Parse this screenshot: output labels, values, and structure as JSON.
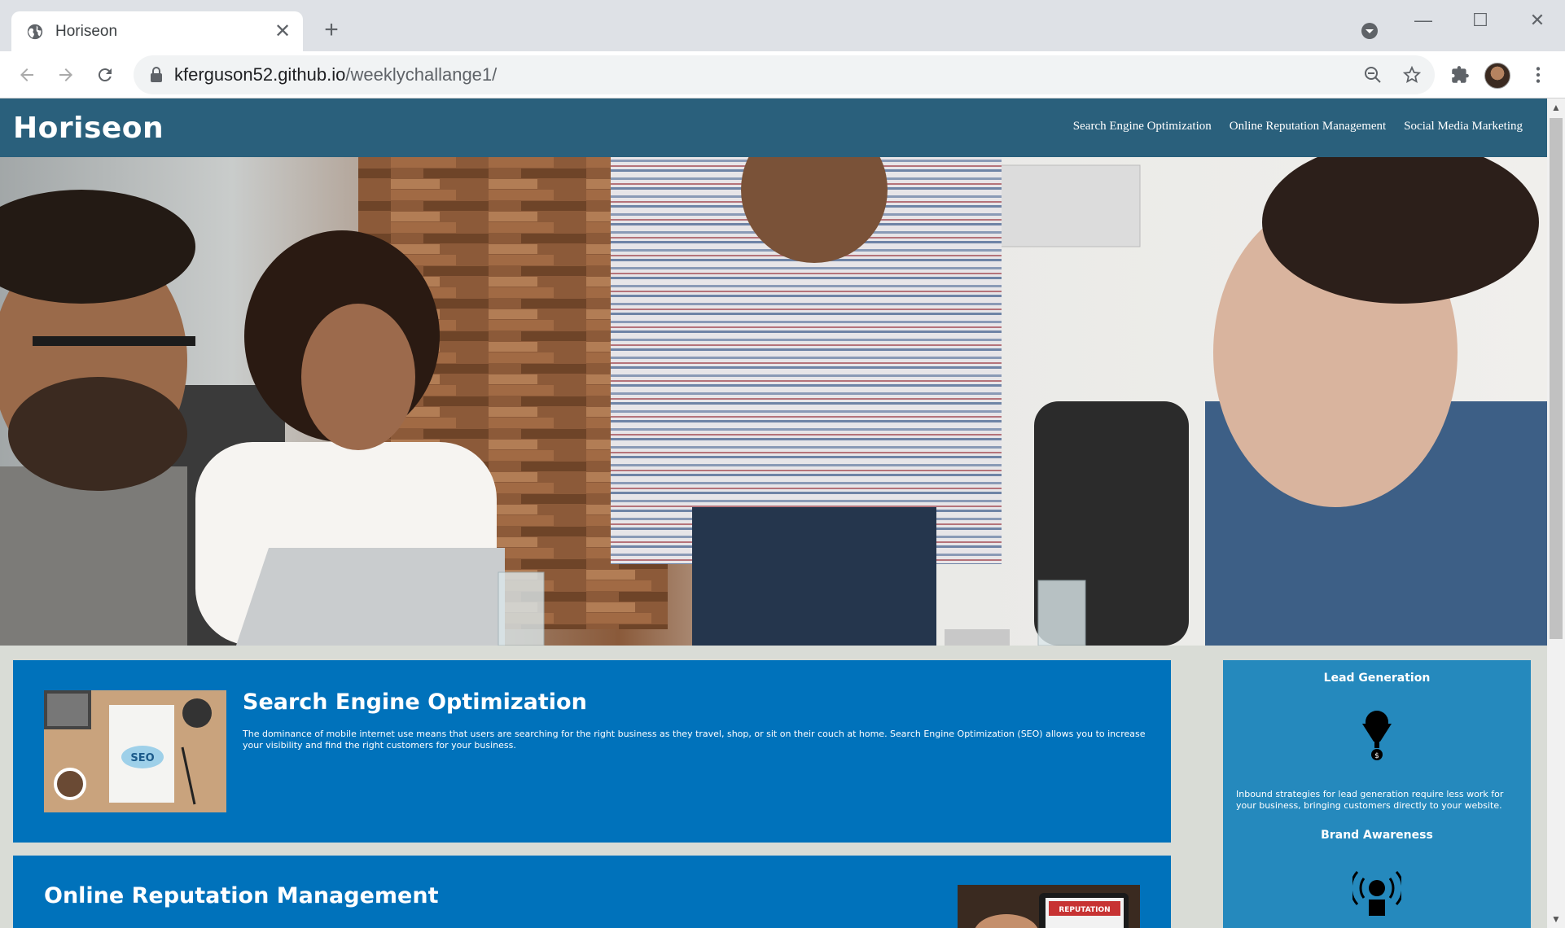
{
  "browser": {
    "tab_title": "Horiseon",
    "url_host": "kferguson52.github.io",
    "url_path": "/weeklychallange1/"
  },
  "site": {
    "logo": "Horiseon",
    "nav": [
      "Search Engine Optimization",
      "Online Reputation Management",
      "Social Media Marketing"
    ]
  },
  "content": {
    "seo": {
      "title": "Search Engine Optimization",
      "text": "The dominance of mobile internet use means that users are searching for the right business as they travel, shop, or sit on their couch at home. Search Engine Optimization (SEO) allows you to increase your visibility and find the right customers for your business.",
      "image_label": "SEO"
    },
    "orm": {
      "title": "Online Reputation Management",
      "image_label": "REPUTATION"
    }
  },
  "aside": {
    "lead_title": "Lead Generation",
    "lead_text": "Inbound strategies for lead generation require less work for your business, bringing customers directly to your website.",
    "brand_title": "Brand Awareness"
  },
  "colors": {
    "header": "#2a607c",
    "card": "#0072bb",
    "aside": "#2589bd",
    "page_bg": "#d9dcd6"
  }
}
